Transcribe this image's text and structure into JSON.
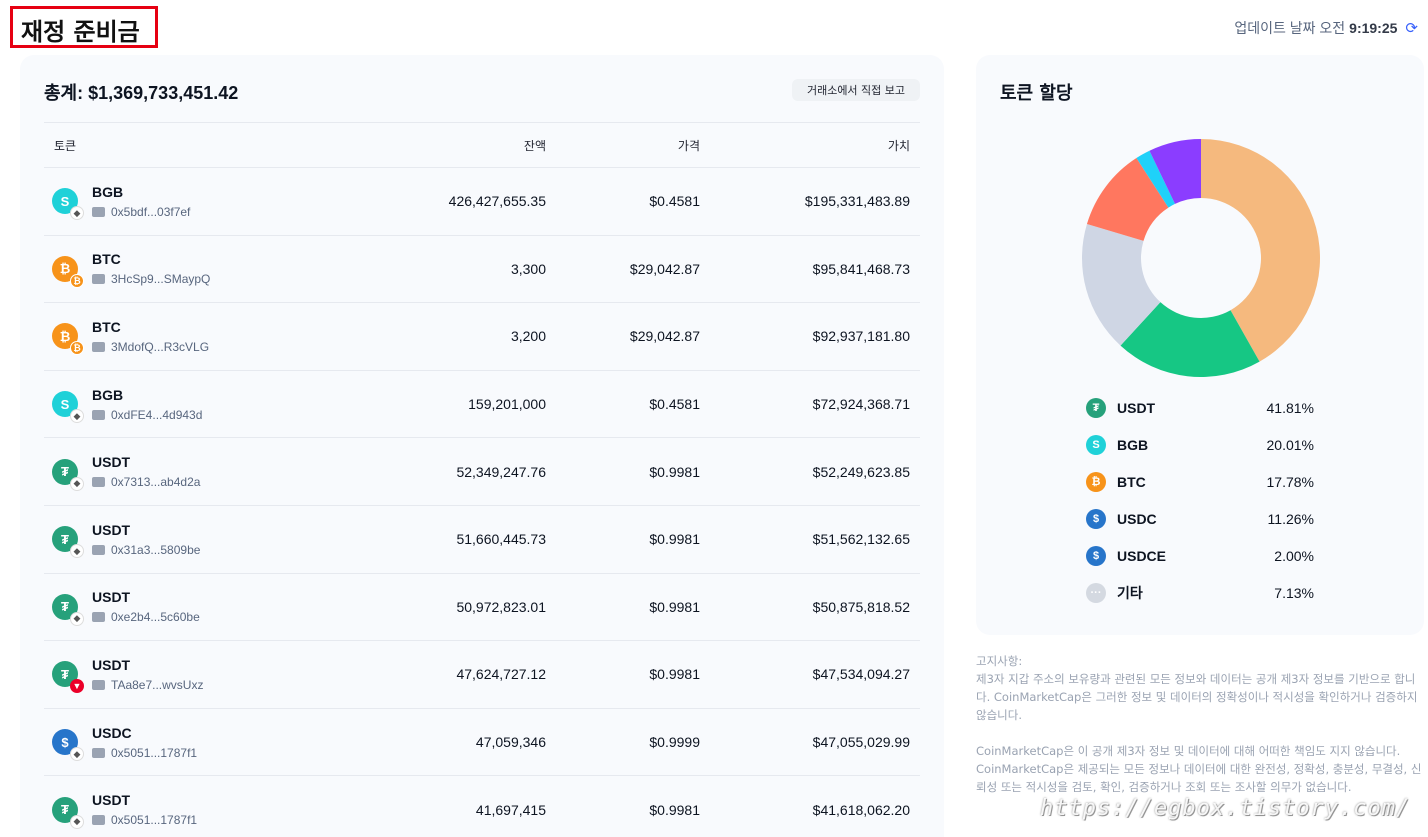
{
  "page_title": "재정 준비금",
  "update": {
    "label": "업데이트 날짜 오전",
    "time": "9:19:25"
  },
  "reserves": {
    "total_label": "총계: $1,369,733,451.42",
    "exchange_button": "거래소에서 직접 보고",
    "columns": {
      "token": "토큰",
      "balance": "잔액",
      "price": "가격",
      "value": "가치"
    },
    "rows": [
      {
        "token": "BGB",
        "address": "0x5bdf...03f7ef",
        "balance": "426,427,655.35",
        "price": "$0.4581",
        "value": "$195,331,483.89",
        "icon": "bgb-icon",
        "chain": "eth"
      },
      {
        "token": "BTC",
        "address": "3HcSp9...SMaypQ",
        "balance": "3,300",
        "price": "$29,042.87",
        "value": "$95,841,468.73",
        "icon": "btc-icon",
        "chain": "btc"
      },
      {
        "token": "BTC",
        "address": "3MdofQ...R3cVLG",
        "balance": "3,200",
        "price": "$29,042.87",
        "value": "$92,937,181.80",
        "icon": "btc-icon",
        "chain": "btc"
      },
      {
        "token": "BGB",
        "address": "0xdFE4...4d943d",
        "balance": "159,201,000",
        "price": "$0.4581",
        "value": "$72,924,368.71",
        "icon": "bgb-icon",
        "chain": "eth"
      },
      {
        "token": "USDT",
        "address": "0x7313...ab4d2a",
        "balance": "52,349,247.76",
        "price": "$0.9981",
        "value": "$52,249,623.85",
        "icon": "usdt-icon",
        "chain": "eth"
      },
      {
        "token": "USDT",
        "address": "0x31a3...5809be",
        "balance": "51,660,445.73",
        "price": "$0.9981",
        "value": "$51,562,132.65",
        "icon": "usdt-icon",
        "chain": "eth"
      },
      {
        "token": "USDT",
        "address": "0xe2b4...5c60be",
        "balance": "50,972,823.01",
        "price": "$0.9981",
        "value": "$50,875,818.52",
        "icon": "usdt-icon",
        "chain": "eth"
      },
      {
        "token": "USDT",
        "address": "TAa8e7...wvsUxz",
        "balance": "47,624,727.12",
        "price": "$0.9981",
        "value": "$47,534,094.27",
        "icon": "usdt-icon",
        "chain": "tron"
      },
      {
        "token": "USDC",
        "address": "0x5051...1787f1",
        "balance": "47,059,346",
        "price": "$0.9999",
        "value": "$47,055,029.99",
        "icon": "usdc-icon",
        "chain": "eth"
      },
      {
        "token": "USDT",
        "address": "0x5051...1787f1",
        "balance": "41,697,415",
        "price": "$0.9981",
        "value": "$41,618,062.20",
        "icon": "usdt-icon",
        "chain": "eth"
      }
    ]
  },
  "allocation": {
    "title": "토큰 할당",
    "items": [
      {
        "name": "USDT",
        "pct": "41.81%",
        "value": 41.81,
        "color": "#f5b97e",
        "icon_color": "#26a17b",
        "icon": "usdt-icon",
        "glyph": "₮"
      },
      {
        "name": "BGB",
        "pct": "20.01%",
        "value": 20.01,
        "color": "#16c784",
        "icon_color": "#1fd1d8",
        "icon": "bgb-icon",
        "glyph": "S"
      },
      {
        "name": "BTC",
        "pct": "17.78%",
        "value": 17.78,
        "color": "#cfd6e4",
        "icon_color": "#f7931a",
        "icon": "btc-icon",
        "glyph": "₿"
      },
      {
        "name": "USDC",
        "pct": "11.26%",
        "value": 11.26,
        "color": "#ff775f",
        "icon_color": "#2775ca",
        "icon": "usdc-icon",
        "glyph": "$"
      },
      {
        "name": "USDCE",
        "pct": "2.00%",
        "value": 2.0,
        "color": "#1fd1f9",
        "icon_color": "#2775ca",
        "icon": "usdc-icon",
        "glyph": "$"
      },
      {
        "name": "기타",
        "pct": "7.13%",
        "value": 7.13,
        "color": "#8b3dff",
        "icon_color": "#d4d9e1",
        "icon": "more-icon",
        "glyph": "···"
      }
    ]
  },
  "disclaimer": {
    "heading": "고지사항:",
    "p1": "제3자 지갑 주소의 보유량과 관련된 모든 정보와 데이터는 공개 제3자 정보를 기반으로 합니다. CoinMarketCap은 그러한 정보 및 데이터의 정확성이나 적시성을 확인하거나 검증하지 않습니다.",
    "p2": "CoinMarketCap은 이 공개 제3자 정보 및 데이터에 대해 어떠한 책임도 지지 않습니다. CoinMarketCap은 제공되는 모든 정보나 데이터에 대한 완전성, 정확성, 충분성, 무결성, 신뢰성 또는 적시성을 검토, 확인, 검증하거나 조회 또는 조사할 의무가 없습니다."
  },
  "watermark": "https://egbox.tistory.com/"
}
